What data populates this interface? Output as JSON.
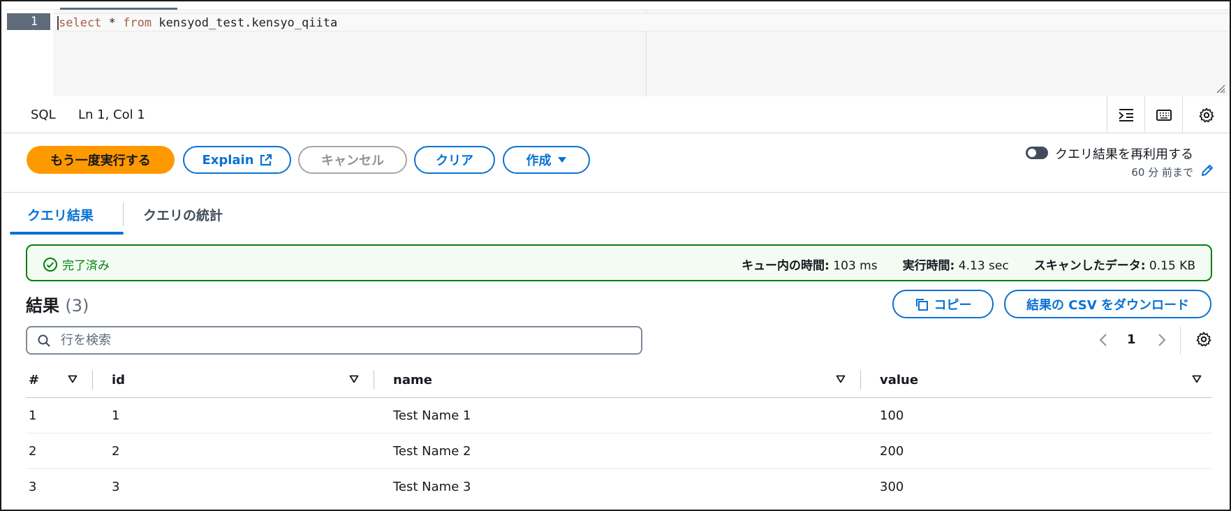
{
  "editor": {
    "line_number": "1",
    "code_keyword_1": "select",
    "code_star": " * ",
    "code_keyword_2": "from",
    "code_table": " kensyod_test.kensyo_qiita"
  },
  "statusbar": {
    "language": "SQL",
    "position": "Ln 1, Col 1",
    "buttons": [
      "indent-icon",
      "keyboard-icon",
      "gear-icon"
    ]
  },
  "actions": {
    "run_again": "もう一度実行する",
    "explain": "Explain",
    "cancel": "キャンセル",
    "clear": "クリア",
    "create": "作成",
    "reuse_label": "クエリ結果を再利用する",
    "reuse_sub": "60 分 前まで",
    "reuse_enabled": false
  },
  "tabs": {
    "results": "クエリ結果",
    "stats": "クエリの統計"
  },
  "alert": {
    "status": "完了済み",
    "queue_label": "キュー内の時間:",
    "queue_value": "103 ms",
    "exec_label": "実行時間:",
    "exec_value": "4.13 sec",
    "scan_label": "スキャンしたデータ:",
    "scan_value": "0.15 KB"
  },
  "results": {
    "title": "結果",
    "count": "(3)",
    "copy": "コピー",
    "csv": "結果の CSV をダウンロード",
    "search_placeholder": "行を検索",
    "page": "1"
  },
  "table": {
    "headers": [
      "#",
      "id",
      "name",
      "value"
    ],
    "rows": [
      [
        "1",
        "1",
        "Test Name 1",
        "100"
      ],
      [
        "2",
        "2",
        "Test Name 2",
        "200"
      ],
      [
        "3",
        "3",
        "Test Name 3",
        "300"
      ]
    ]
  },
  "colors": {
    "accent": "#0972d3",
    "primary_button": "#ff9900",
    "success": "#037f0c"
  }
}
